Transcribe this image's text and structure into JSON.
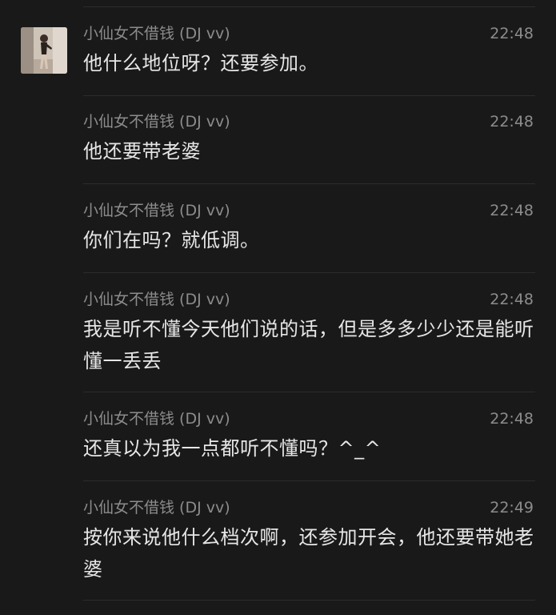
{
  "messages": [
    {
      "sender": "小仙女不借钱 (DJ vv)",
      "time": "22:48",
      "text": "他什么地位呀？还要参加。"
    },
    {
      "sender": "小仙女不借钱 (DJ vv)",
      "time": "22:48",
      "text": "他还要带老婆"
    },
    {
      "sender": "小仙女不借钱 (DJ vv)",
      "time": "22:48",
      "text": "你们在吗？就低调。"
    },
    {
      "sender": "小仙女不借钱 (DJ vv)",
      "time": "22:48",
      "text": "我是听不懂今天他们说的话，但是多多少少还是能听懂一丢丢"
    },
    {
      "sender": "小仙女不借钱 (DJ vv)",
      "time": "22:48",
      "text": "还真以为我一点都听不懂吗？^_^"
    },
    {
      "sender": "小仙女不借钱 (DJ vv)",
      "time": "22:49",
      "text": "按你来说他什么档次啊，还参加开会，他还要带她老婆"
    }
  ]
}
